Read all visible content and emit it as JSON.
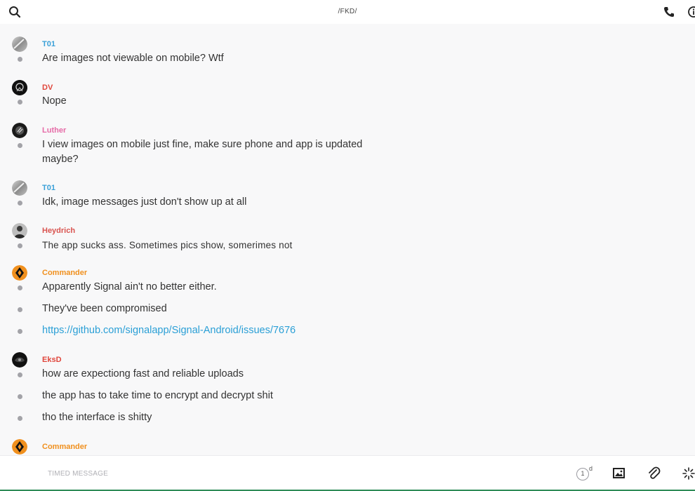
{
  "header": {
    "title": "/FKD/",
    "search_icon": "search-icon",
    "call_icon": "phone-icon",
    "info_icon": "info-icon"
  },
  "colors": {
    "link": "#2a9fd6",
    "T01": "#3aa0d8",
    "DV": "#e0463c",
    "Luther": "#e66ba7",
    "Heydrich": "#d9534f",
    "Commander": "#f0901e",
    "EksD": "#e0463c"
  },
  "messages": [
    {
      "author": "T01",
      "lines": [
        "Are images not viewable on mobile? Wtf"
      ]
    },
    {
      "author": "DV",
      "lines": [
        "Nope"
      ]
    },
    {
      "author": "Luther",
      "lines": [
        "I view images on mobile just fine, make sure phone and app is updated",
        "maybe?"
      ]
    },
    {
      "author": "T01",
      "lines": [
        "Idk, image messages just don't show up at all"
      ]
    },
    {
      "author": "Heydrich",
      "lines": [
        "The app sucks ass. Sometimes pics show, somerimes not"
      ]
    },
    {
      "author": "Commander",
      "lines": [
        "Apparently Signal ain't no better either.",
        "They've been compromised",
        "https://github.com/signalapp/Signal-Android/issues/7676"
      ]
    },
    {
      "author": "EksD",
      "lines": [
        "how are expectiong fast and reliable uploads",
        "the app has to take time to encrypt and decrypt shit",
        "tho the interface is shitty"
      ]
    },
    {
      "author": "Commander",
      "lines": []
    }
  ],
  "composer": {
    "placeholder": "TIMED MESSAGE",
    "timer_value": "1",
    "timer_unit": "d",
    "image_icon": "image-icon",
    "attach_icon": "paperclip-icon",
    "sticker_icon": "sparkle-icon"
  }
}
